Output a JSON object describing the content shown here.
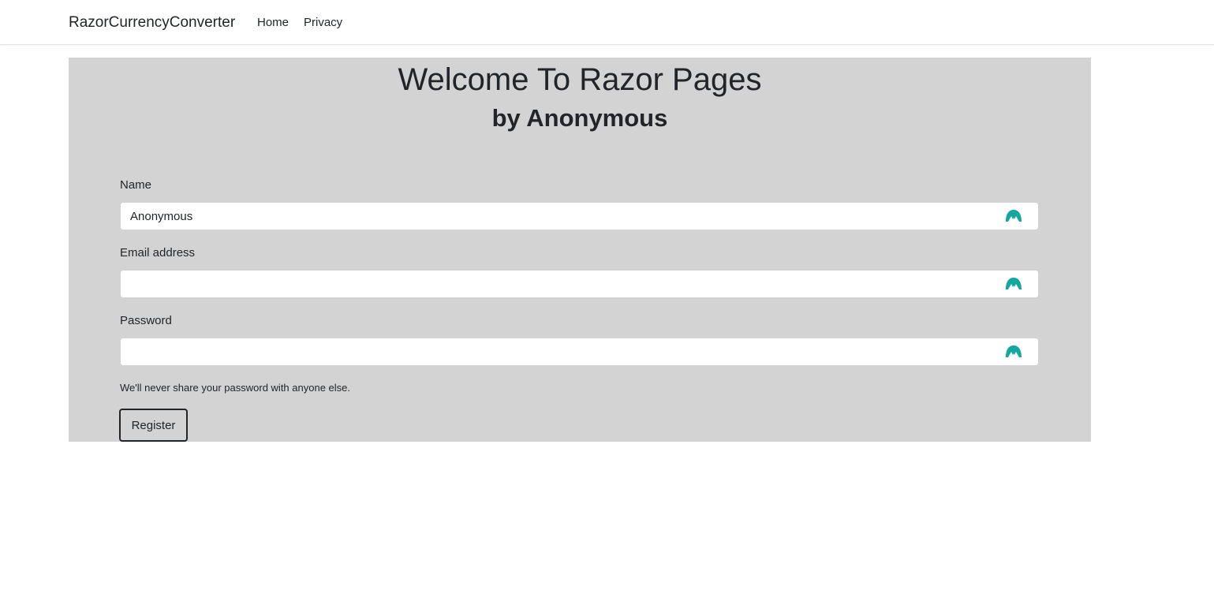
{
  "navbar": {
    "brand": "RazorCurrencyConverter",
    "links": [
      {
        "label": "Home"
      },
      {
        "label": "Privacy"
      }
    ]
  },
  "hero": {
    "title": "Welcome To Razor Pages",
    "subtitle": "by Anonymous"
  },
  "form": {
    "name": {
      "label": "Name",
      "value": "Anonymous",
      "placeholder": ""
    },
    "email": {
      "label": "Email address",
      "value": "",
      "placeholder": ""
    },
    "password": {
      "label": "Password",
      "value": "",
      "placeholder": ""
    },
    "help_text": "We'll never share your password with anyone else.",
    "submit_label": "Register"
  },
  "icons": {
    "field_extension_icon": "password-manager-icon"
  },
  "colors": {
    "panel_background": "#d3d3d3",
    "icon_teal": "#12a8a0",
    "text": "#212529"
  }
}
